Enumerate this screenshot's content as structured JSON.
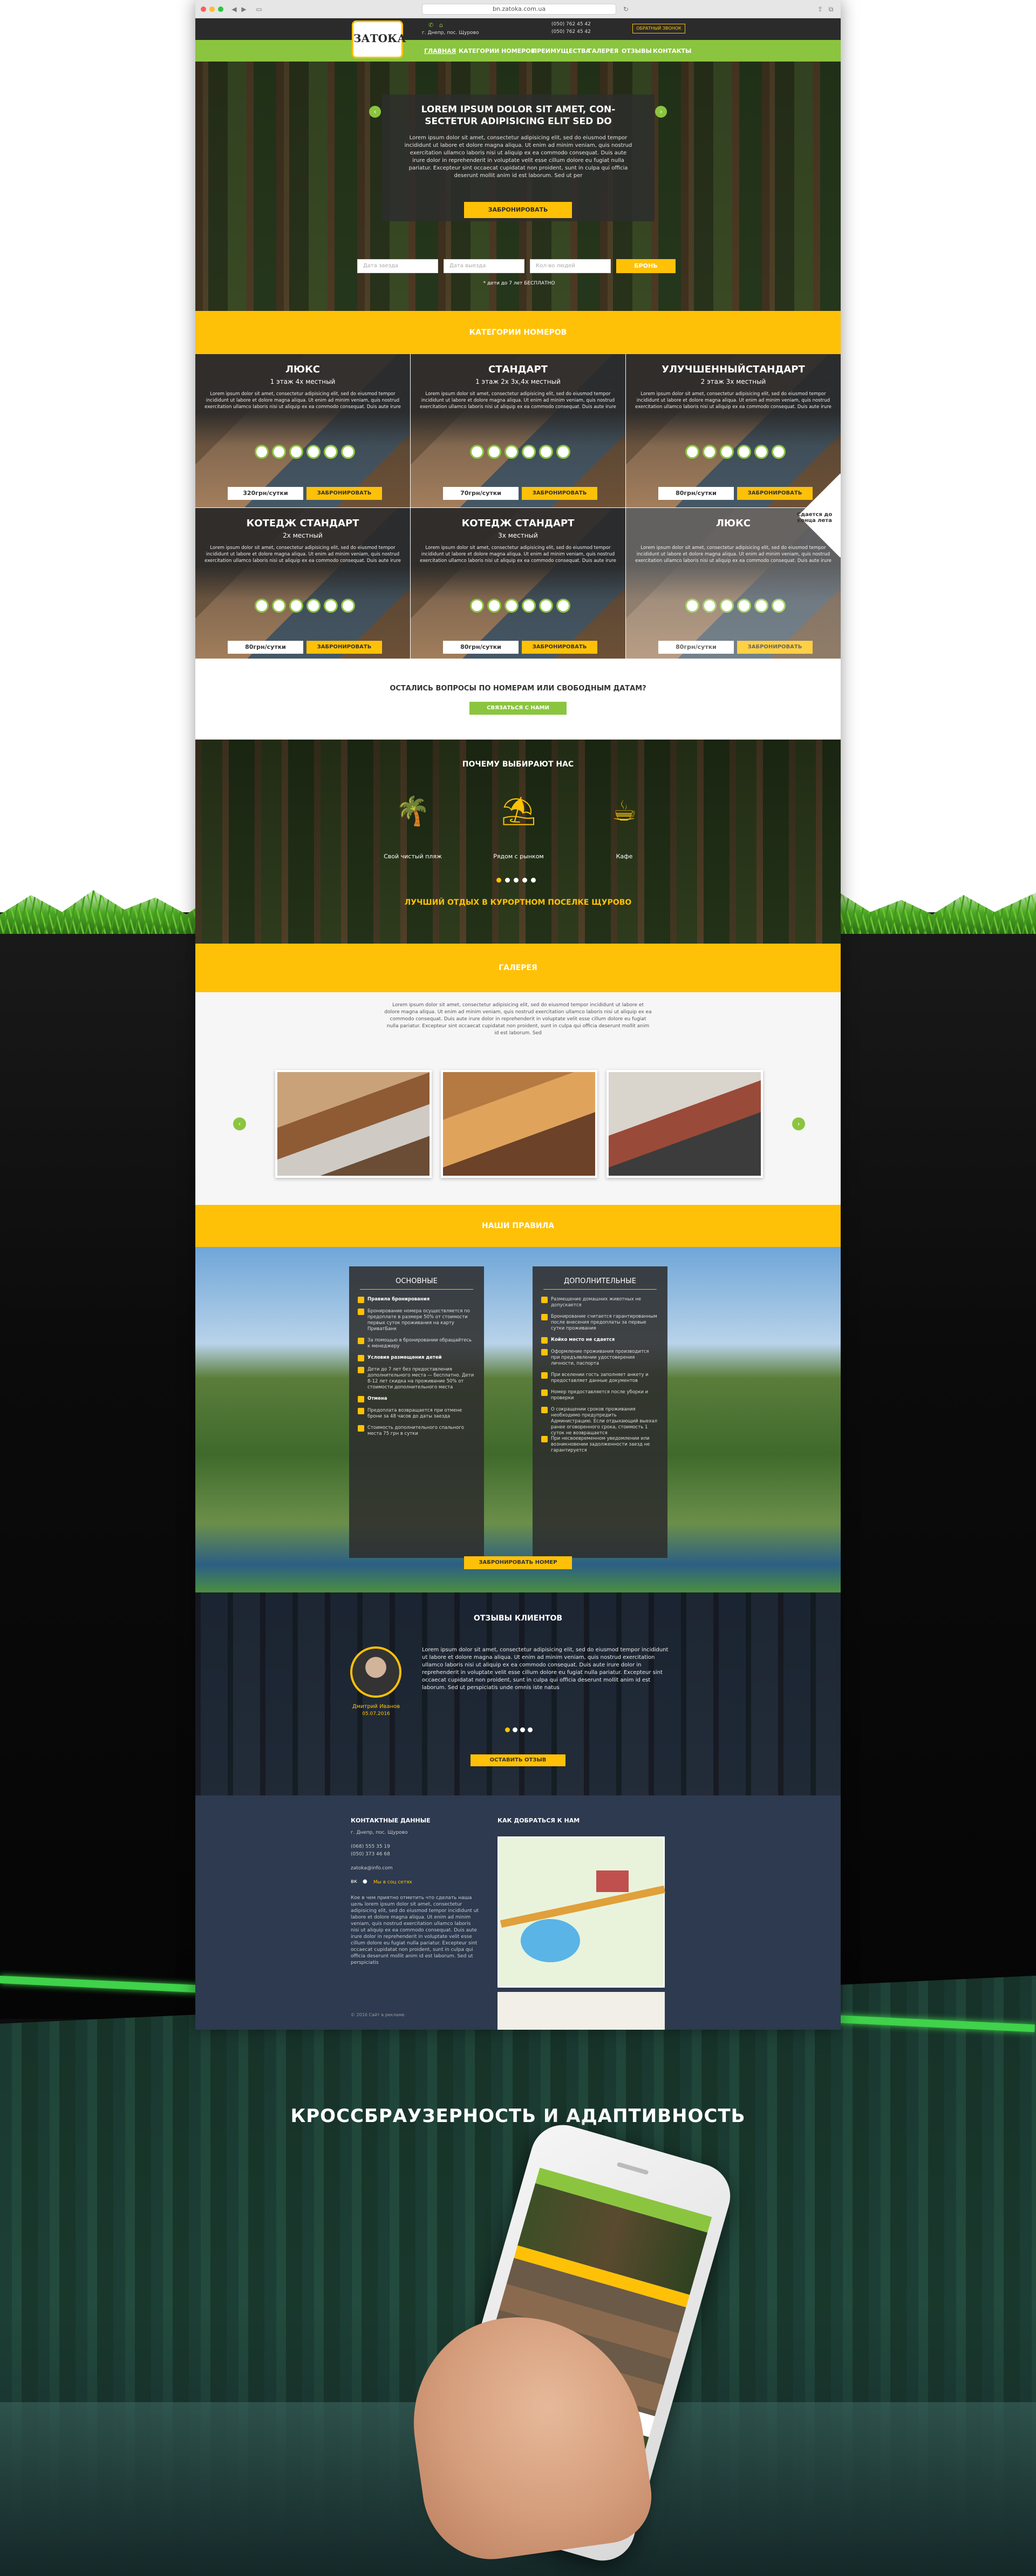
{
  "browser": {
    "url": "bn.zatoka.com.ua"
  },
  "site": {
    "logo_main": "ЗАТОКА",
    "logo_sub": "ЗАТОКА",
    "address": "г. Днепр, пос. Щурово",
    "phone1": "(050) 762 45 42",
    "phone2": "(050) 762 45 42",
    "callback": "ОБРАТНЫЙ ЗВОНОК",
    "nav": [
      "ГЛАВНАЯ",
      "КАТЕГОРИИ НОМЕРОВ",
      "ПРЕИМУЩЕСТВА",
      "ГАЛЕРЕЯ",
      "ОТЗЫВЫ",
      "КОНТАКТЫ"
    ]
  },
  "hero": {
    "title1": "LOREM IPSUM DOLOR SIT AMET, CON-",
    "title2": "SECTETUR ADIPISICING ELIT SED DO",
    "text": "Lorem ipsum dolor sit amet, consectetur adipisicing elit, sed do eiusmod tempor incididunt ut labore et dolore magna aliqua. Ut enim ad minim veniam, quis nostrud exercitation ullamco laboris nisi ut aliquip ex ea commodo consequat. Duis aute irure dolor in reprehenderit in voluptate velit esse cillum dolore eu fugiat nulla pariatur. Excepteur sint occaecat cupidatat non proident, sunt in culpa qui officia deserunt mollit anim id est laborum. Sed ut per",
    "button": "ЗАБРОНИРОВАТЬ",
    "date_in": "Дата заезда",
    "date_out": "Дата выезда",
    "guests": "Кол-во людей",
    "book": "БРОНЬ",
    "note": "* дети до 7 лет БЕСПЛАТНО"
  },
  "rooms_section": {
    "title": "КАТЕГОРИИ НОМЕРОВ",
    "room_text": "Lorem ipsum dolor sit amet, consectetur adipisicing elit, sed do eiusmod tempor incididunt ut labore et dolore magna aliqua. Ut enim ad minim veniam, quis nostrud exercitation ullamco laboris nisi ut aliquip ex ea commodo consequat. Duis aute irure",
    "book_btn": "ЗАБРОНИРОВАТЬ",
    "rooms": [
      {
        "title": "ЛЮКС",
        "sub": "1 этаж 4х местный",
        "price": "320грн/сутки"
      },
      {
        "title": "СТАНДАРТ",
        "sub": "1 этаж 2х 3х,4х местный",
        "price": "70грн/сутки"
      },
      {
        "title": "УЛУЧШЕННЫЙСТАНДАРТ",
        "sub": "2 этаж 3х местный",
        "price": "80грн/сутки"
      },
      {
        "title": "КОТЕДЖ СТАНДАРТ",
        "sub": "2х местный",
        "price": "80грн/сутки"
      },
      {
        "title": "КОТЕДЖ СТАНДАРТ",
        "sub": "3х местный",
        "price": "80грн/сутки"
      },
      {
        "title": "ЛЮКС",
        "sub": "",
        "price": "80грн/сутки"
      }
    ],
    "ribbon": "Сдается до конца лета"
  },
  "questions": {
    "text": "ОСТАЛИСЬ ВОПРОСЫ ПО НОМЕРАМ ИЛИ СВОБОДНЫМ ДАТАМ?",
    "button": "СВЯЗАТЬСЯ С НАМИ"
  },
  "why": {
    "title": "ПОЧЕМУ ВЫБИРАЮТ НАС",
    "items": [
      "Свой чистый пляж",
      "Рядом с рынком",
      "Кафе"
    ],
    "slogan": "ЛУЧШИЙ ОТДЫХ В КУРОРТНОМ ПОСЕЛКЕ ЩУРОВО"
  },
  "gallery": {
    "title": "ГАЛЕРЕЯ",
    "text": "Lorem ipsum dolor sit amet, consectetur adipisicing elit, sed do eiusmod tempor incididunt ut labore et dolore magna aliqua. Ut enim ad minim veniam, quis nostrud exercitation ullamco laboris nisi ut aliquip ex ea commodo consequat. Duis aute irure dolor in reprehenderit in voluptate velit esse cillum dolore eu fugiat nulla pariatur. Excepteur sint occaecat cupidatat non proident, sunt in culpa qui officia deserunt mollit anim id est laborum. Sed"
  },
  "rules": {
    "title": "НАШИ ПРАВИЛА",
    "basic_title": "ОСНОВНЫЕ",
    "basic": [
      "Правила бронирования",
      "Бронирование номера осуществляется по предоплате в размере 50% от стоимости первых суток проживания на карту ПриватБанк",
      "За помощью в бронировании обращайтесь к менеджеру",
      "Условия размещения детей",
      "Дети до 7 лет без предоставления дополнительного места — бесплатно. Дети 8-12 лет скидка на проживание 50% от стоимости дополнительного места",
      "Отмена",
      "Предоплата возвращается при отмене брони за 48 часов до даты заезда",
      "Стоимость дополнительного спального места 75 грн в сутки"
    ],
    "extra_title": "ДОПОЛНИТЕЛЬНЫЕ",
    "extra": [
      "Размещение домашних животных не допускается",
      "Бронирование считается гарантированным после внесения предоплаты за первые сутки проживания",
      "Койко место не сдается",
      "Оформление проживания производится при предъявлении удостоверения личности, паспорта",
      "При вселении гость заполняет анкету и предоставляет данные документов",
      "Номер предоставляется после уборки и проверки",
      "О сокращении сроков проживания необходимо предупредить Администрацию. Если отдыхающий выехал ранее оговоренного срока, стоимость 1 суток не возвращается",
      "При несвоевременном уведомлении или возникновении задолженности заезд не гарантируется"
    ],
    "button": "ЗАБРОНИРОВАТЬ НОМЕР"
  },
  "reviews": {
    "title": "ОТЗЫВЫ КЛИЕНТОВ",
    "author": "Дмитрий Иванов",
    "date": "05.07.2016",
    "text": "Lorem ipsum dolor sit amet, consectetur adipisicing elit, sed do eiusmod tempor incididunt ut labore et dolore magna aliqua. Ut enim ad minim veniam, quis nostrud exercitation ullamco laboris nisi ut aliquip ex ea commodo consequat. Duis aute irure dolor in reprehenderit in voluptate velit esse cillum dolore eu fugiat nulla pariatur. Excepteur sint occaecat cupidatat non proident, sunt in culpa qui officia deserunt mollit anim id est laborum. Sed ut perspiciatis unde omnis iste natus",
    "button": "ОСТАВИТЬ ОТЗЫВ"
  },
  "footer": {
    "contacts_title": "КОНТАКТНЫЕ ДАННЫЕ",
    "map_title": "КАК ДОБРАТЬСЯ К НАМ",
    "address": "г. Днепр, пос. Щурово",
    "phones": [
      "(068) 555 35 19",
      "(050) 373 46 68"
    ],
    "email": "zatoka@info.com",
    "social_note": "Мы в соц сетях",
    "about": "Кое в чем приятно отметить что сделать наша цель lorem ipsum dolor sit amet, consectetur adipisicing elit, sed do eiusmod tempor incididunt ut labore et dolore magna aliqua. Ut enim ad minim veniam, quis nostrud exercitation ullamco laboris nisi ut aliquip ex ea commodo consequat. Duis aute irure dolor in reprehenderit in voluptate velit esse cillum dolore eu fugiat nulla pariatur. Excepteur sint occaecat cupidatat non proident, sunt in culpa qui officia deserunt mollit anim id est laborum. Sed ut perspiciatis",
    "copyright": "© 2016 Сайт в рекламе"
  },
  "promo": {
    "title": "КРОССБРАУЗЕРНОСТЬ И АДАПТИВНОСТЬ"
  },
  "colors": {
    "accent_yellow": "#ffc107",
    "accent_green": "#8bc53f",
    "dark_panel": "#2d2d2d"
  }
}
